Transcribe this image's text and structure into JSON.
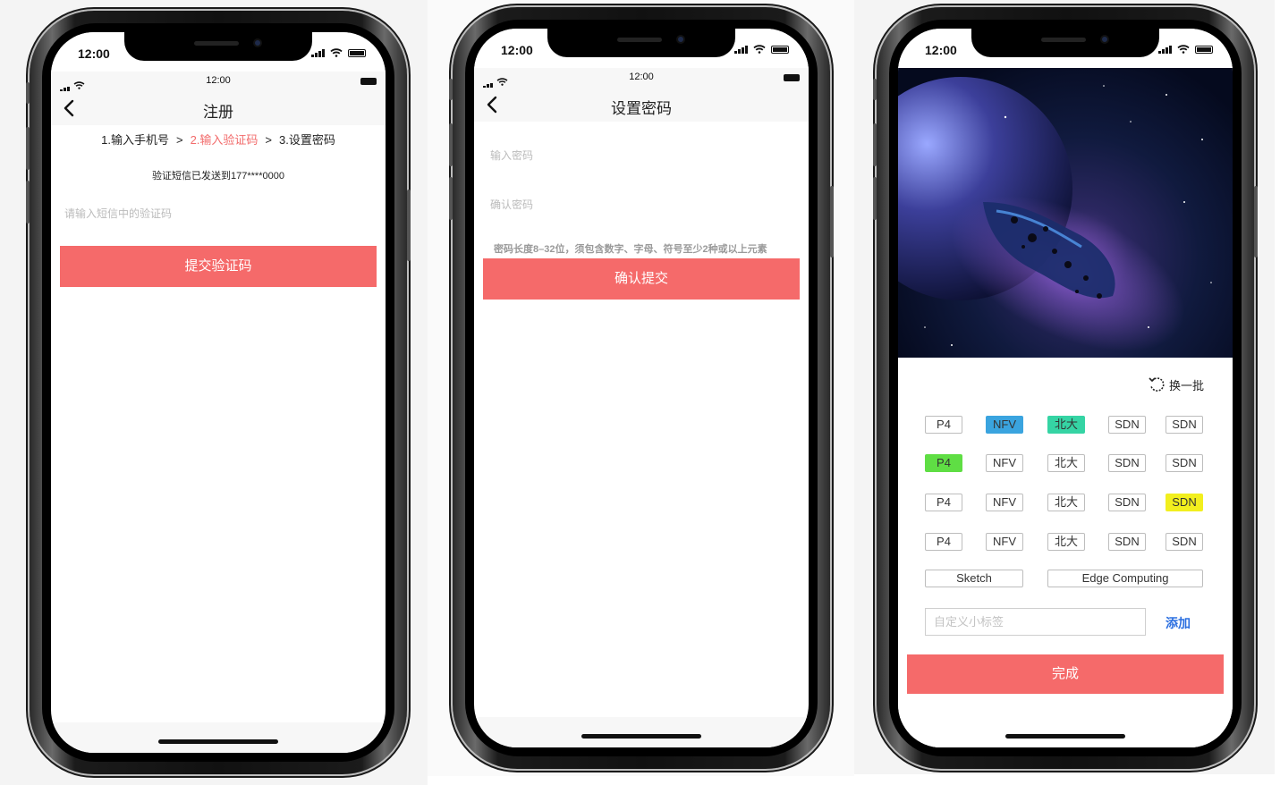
{
  "status": {
    "time": "12:00",
    "app_time": "12:00"
  },
  "screen1": {
    "title": "注册",
    "steps": [
      "1.输入手机号",
      "2.输入验证码",
      "3.设置密码"
    ],
    "step_sep": ">",
    "sms_note": "验证短信已发送到177****0000",
    "code_placeholder": "请输入短信中的验证码",
    "submit_label": "提交验证码"
  },
  "screen2": {
    "title": "设置密码",
    "password_placeholder": "输入密码",
    "confirm_placeholder": "确认密码",
    "hint": "密码长度8–32位，须包含数字、字母、符号至少2种或以上元素",
    "submit_label": "确认提交"
  },
  "screen3": {
    "refresh_label": "换一批",
    "tag_rows": [
      [
        {
          "label": "P4",
          "color": ""
        },
        {
          "label": "NFV",
          "color": "#3aa4df"
        },
        {
          "label": "北大",
          "color": "#35d4a4"
        },
        {
          "label": "SDN",
          "color": ""
        },
        {
          "label": "SDN",
          "color": ""
        }
      ],
      [
        {
          "label": "P4",
          "color": "#5fde44"
        },
        {
          "label": "NFV",
          "color": ""
        },
        {
          "label": "北大",
          "color": ""
        },
        {
          "label": "SDN",
          "color": ""
        },
        {
          "label": "SDN",
          "color": ""
        }
      ],
      [
        {
          "label": "P4",
          "color": ""
        },
        {
          "label": "NFV",
          "color": ""
        },
        {
          "label": "北大",
          "color": ""
        },
        {
          "label": "SDN",
          "color": ""
        },
        {
          "label": "SDN",
          "color": "#f2ef1e"
        }
      ],
      [
        {
          "label": "P4",
          "color": ""
        },
        {
          "label": "NFV",
          "color": ""
        },
        {
          "label": "北大",
          "color": ""
        },
        {
          "label": "SDN",
          "color": ""
        },
        {
          "label": "SDN",
          "color": ""
        }
      ]
    ],
    "wide_tags": [
      "Sketch",
      "Edge Computing"
    ],
    "custom_placeholder": "自定义小标签",
    "add_label": "添加",
    "done_label": "完成"
  },
  "colors": {
    "accent": "#f56a6a",
    "link": "#2b6fe0"
  }
}
